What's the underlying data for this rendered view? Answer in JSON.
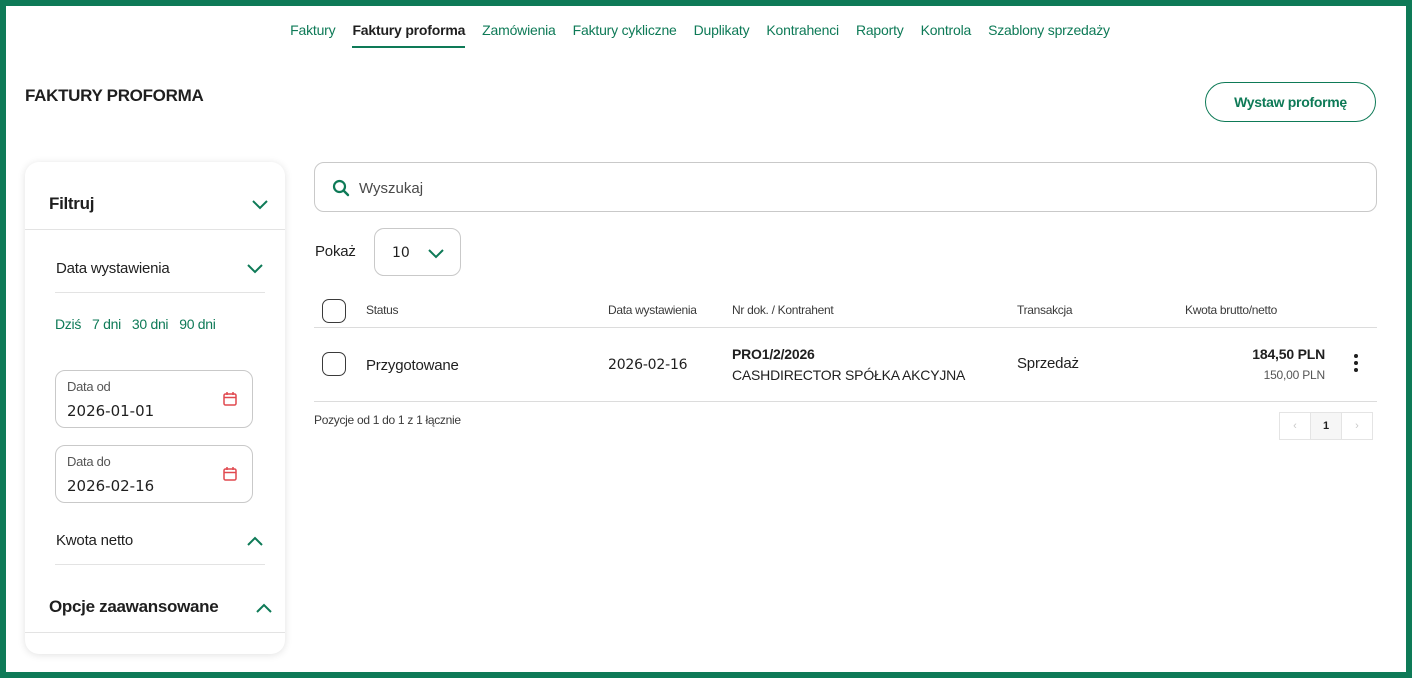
{
  "nav": {
    "items": [
      {
        "label": "Faktury",
        "active": false
      },
      {
        "label": "Faktury proforma",
        "active": true
      },
      {
        "label": "Zamówienia",
        "active": false
      },
      {
        "label": "Faktury cykliczne",
        "active": false
      },
      {
        "label": "Duplikaty",
        "active": false
      },
      {
        "label": "Kontrahenci",
        "active": false
      },
      {
        "label": "Raporty",
        "active": false
      },
      {
        "label": "Kontrola",
        "active": false
      },
      {
        "label": "Szablony sprzedaży",
        "active": false
      }
    ]
  },
  "page": {
    "title": "FAKTURY PROFORMA",
    "primary_action": "Wystaw proformę"
  },
  "filters": {
    "title": "Filtruj",
    "date_section": "Data wystawienia",
    "quick_ranges": [
      "Dziś",
      "7 dni",
      "30 dni",
      "90 dni"
    ],
    "date_from_label": "Data od",
    "date_from_value": "2026-01-01",
    "date_to_label": "Data do",
    "date_to_value": "2026-02-16",
    "amount_section": "Kwota netto",
    "advanced_section": "Opcje zaawansowane"
  },
  "search": {
    "placeholder": "Wyszukaj"
  },
  "page_size": {
    "label": "Pokaż",
    "value": "10"
  },
  "table": {
    "columns": {
      "status": "Status",
      "date": "Data wystawienia",
      "doc": "Nr dok. / Kontrahent",
      "transaction": "Transakcja",
      "amount": "Kwota brutto/netto"
    },
    "rows": [
      {
        "status": "Przygotowane",
        "date": "2026-02-16",
        "doc_number": "PRO1/2/2026",
        "contractor": "CASHDIRECTOR SPÓŁKA AKCYJNA",
        "transaction": "Sprzedaż",
        "gross": "184,50 PLN",
        "net": "150,00 PLN"
      }
    ],
    "summary": "Pozycje od 1 do 1 z 1 łącznie"
  },
  "pagination": {
    "prev": "‹",
    "current": "1",
    "next": "›"
  },
  "colors": {
    "brand": "#0e7a57",
    "calendar_icon": "#e0484f"
  }
}
